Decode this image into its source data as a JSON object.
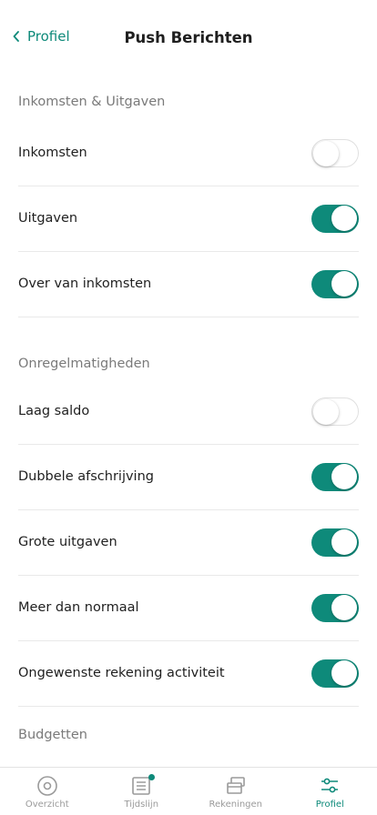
{
  "header": {
    "back_label": "Profiel",
    "title": "Push Berichten"
  },
  "sections": [
    {
      "title": "Inkomsten & Uitgaven",
      "items": [
        {
          "label": "Inkomsten",
          "enabled": false
        },
        {
          "label": "Uitgaven",
          "enabled": true
        },
        {
          "label": "Over van inkomsten",
          "enabled": true
        }
      ]
    },
    {
      "title": "Onregelmatigheden",
      "items": [
        {
          "label": "Laag saldo",
          "enabled": false
        },
        {
          "label": "Dubbele afschrijving",
          "enabled": true
        },
        {
          "label": "Grote uitgaven",
          "enabled": true
        },
        {
          "label": "Meer dan normaal",
          "enabled": true
        },
        {
          "label": "Ongewenste rekening activiteit",
          "enabled": true
        }
      ]
    },
    {
      "title": "Budgetten",
      "items": []
    }
  ],
  "tabbar": {
    "tabs": [
      {
        "label": "Overzicht",
        "icon": "overview-icon",
        "active": false,
        "badge": false
      },
      {
        "label": "Tijdslijn",
        "icon": "timeline-icon",
        "active": false,
        "badge": true
      },
      {
        "label": "Rekeningen",
        "icon": "accounts-icon",
        "active": false,
        "badge": false
      },
      {
        "label": "Profiel",
        "icon": "profile-sliders-icon",
        "active": true,
        "badge": false
      }
    ]
  },
  "colors": {
    "accent": "#0e8a7a",
    "toggle_off": "#ffffff",
    "divider": "#e9e9e9"
  }
}
